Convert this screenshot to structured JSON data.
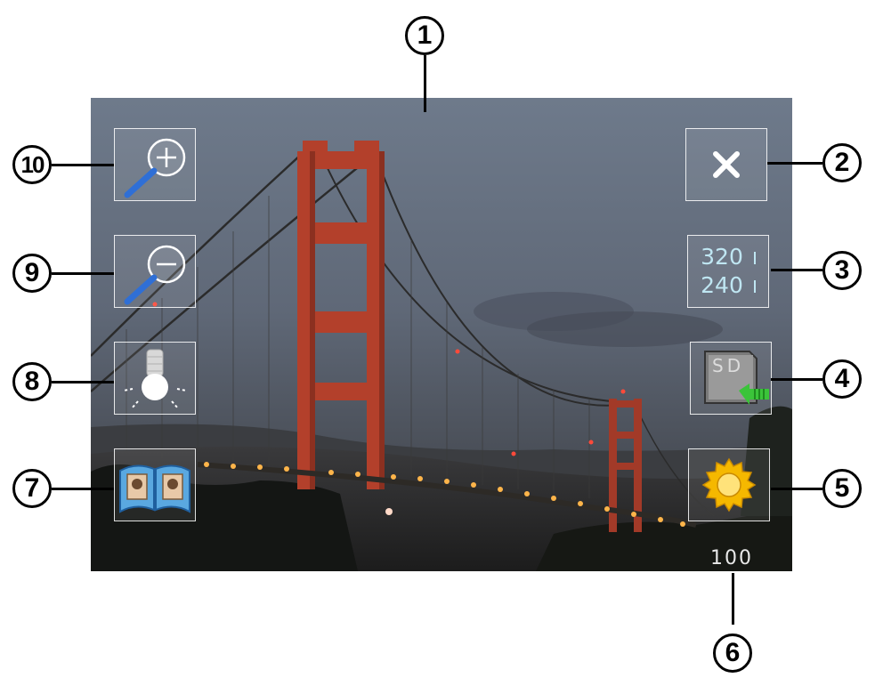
{
  "callouts": {
    "c1": "1",
    "c2": "2",
    "c3": "3",
    "c4": "4",
    "c5": "5",
    "c6": "6",
    "c7": "7",
    "c8": "8",
    "c9": "9",
    "c10": "10"
  },
  "screen": {
    "resolution": {
      "width": "320",
      "height": "240"
    },
    "storage_label": "SD",
    "shot_counter": "100"
  },
  "icons": {
    "zoom_in": "zoom-in-icon",
    "zoom_out": "zoom-out-icon",
    "light": "light-bulb-icon",
    "album": "photo-album-icon",
    "close": "close-icon",
    "resolution": "resolution-icon",
    "storage": "sd-card-icon",
    "settings": "gear-icon"
  },
  "colors": {
    "bridge": "#b8402a",
    "sky_top": "#6f7c8c",
    "icon_blue": "#2f6fd6",
    "arrow_green": "#3bc43a",
    "gear_yellow": "#f5b800"
  }
}
